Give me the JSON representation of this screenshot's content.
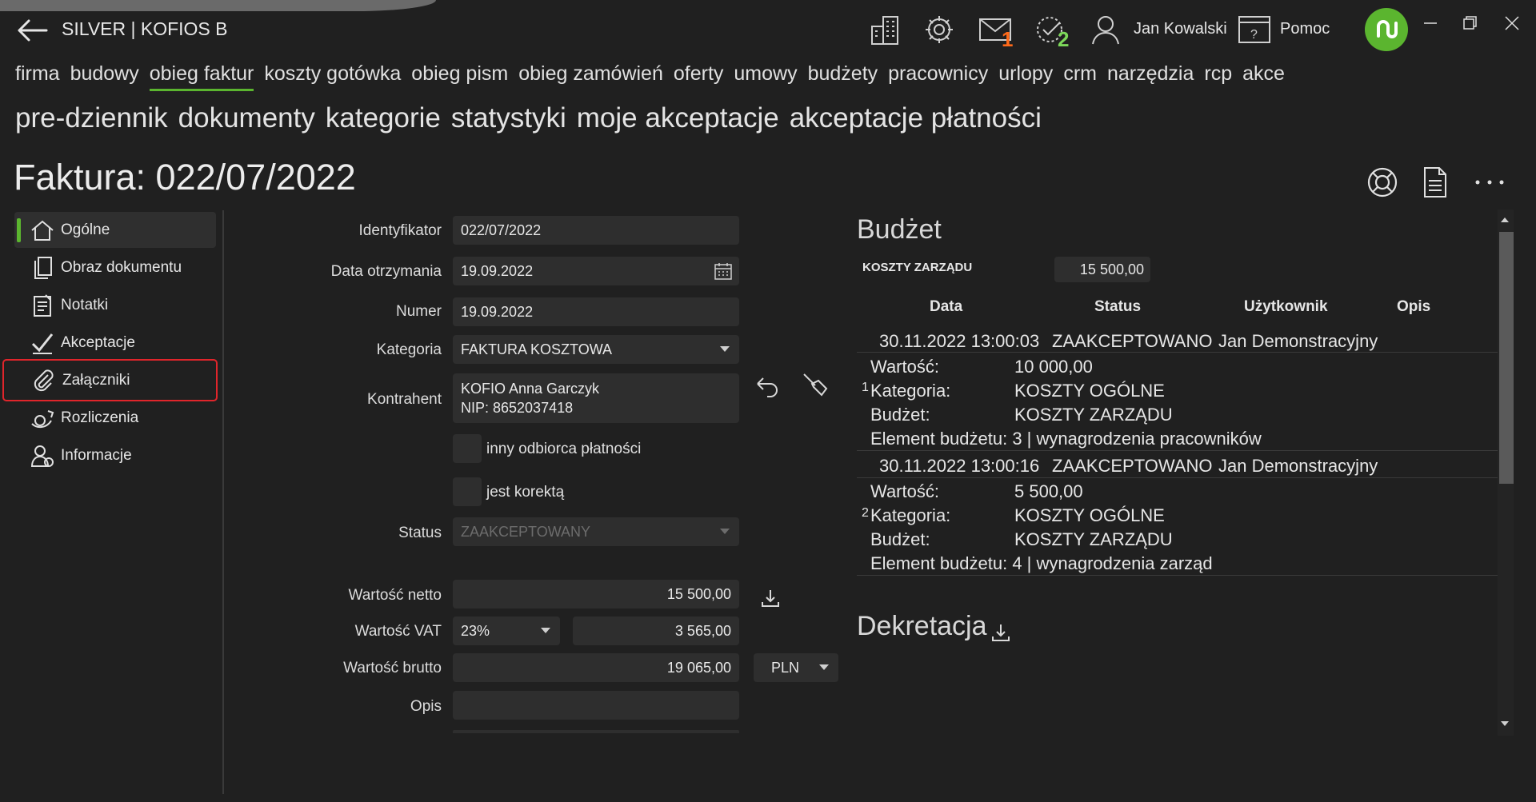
{
  "app": {
    "title": "SILVER | KOFIOS B",
    "user": "Jan Kowalski",
    "help": "Pomoc"
  },
  "badges": {
    "mail": "1",
    "tasks": "2"
  },
  "colors": {
    "accent": "#5bb52f",
    "mail_badge": "#ff6a1a",
    "task_badge": "#7dd85a",
    "highlight": "#e0252b"
  },
  "nav1": [
    "firma",
    "budowy",
    "obieg faktur",
    "koszty gotówka",
    "obieg pism",
    "obieg zamówień",
    "oferty",
    "umowy",
    "budżety",
    "pracownicy",
    "urlopy",
    "crm",
    "narzędzia",
    "rcp",
    "akce"
  ],
  "nav2": [
    "pre-dziennik",
    "dokumenty",
    "kategorie",
    "statystyki",
    "moje akceptacje",
    "akceptacje płatności"
  ],
  "page_title": "Faktura: 022/07/2022",
  "sidebar": [
    {
      "label": "Ogólne",
      "icon": "home-icon"
    },
    {
      "label": "Obraz dokumentu",
      "icon": "document-image-icon"
    },
    {
      "label": "Notatki",
      "icon": "notes-icon"
    },
    {
      "label": "Akceptacje",
      "icon": "checkmark-icon"
    },
    {
      "label": "Załączniki",
      "icon": "paperclip-icon"
    },
    {
      "label": "Rozliczenia",
      "icon": "settlement-icon"
    },
    {
      "label": "Informacje",
      "icon": "info-person-icon"
    }
  ],
  "form": {
    "identyfikator_label": "Identyfikator",
    "identyfikator": "022/07/2022",
    "data_otrzymania_label": "Data otrzymania",
    "data_otrzymania": "19.09.2022",
    "numer_label": "Numer",
    "numer": "19.09.2022",
    "kategoria_label": "Kategoria",
    "kategoria": "FAKTURA KOSZTOWA",
    "kontrahent_label": "Kontrahent",
    "kontrahent_name": "KOFIO Anna Garczyk",
    "kontrahent_nip": "NIP: 8652037418",
    "inny_odbiorca": "inny odbiorca płatności",
    "jest_korekta": "jest korektą",
    "status_label": "Status",
    "status": "ZAAKCEPTOWANY",
    "netto_label": "Wartość netto",
    "netto": "15 500,00",
    "vat_label": "Wartość VAT",
    "vat_rate": "23%",
    "vat": "3 565,00",
    "brutto_label": "Wartość brutto",
    "brutto": "19 065,00",
    "currency": "PLN",
    "opis_label": "Opis",
    "opis": ""
  },
  "budget": {
    "heading": "Budżet",
    "category": "KOSZTY ZARZĄDU",
    "category_value": "15 500,00",
    "headers": {
      "data": "Data",
      "status": "Status",
      "user": "Użytkownik",
      "opis": "Opis"
    },
    "entries": [
      {
        "index": "1",
        "date": "30.11.2022 13:00:03",
        "status": "ZAAKCEPTOWANO",
        "user": "Jan Demonstracyjny",
        "wartosc_label": "Wartość:",
        "wartosc": "10 000,00",
        "kategoria_label": "Kategoria:",
        "kategoria": "KOSZTY OGÓLNE",
        "budzet_label": "Budżet:",
        "budzet": "KOSZTY ZARZĄDU",
        "element": "Element budżetu: 3 | wynagrodzenia pracowników"
      },
      {
        "index": "2",
        "date": "30.11.2022 13:00:16",
        "status": "ZAAKCEPTOWANO",
        "user": "Jan Demonstracyjny",
        "wartosc_label": "Wartość:",
        "wartosc": "5 500,00",
        "kategoria_label": "Kategoria:",
        "kategoria": "KOSZTY OGÓLNE",
        "budzet_label": "Budżet:",
        "budzet": "KOSZTY ZARZĄDU",
        "element": "Element budżetu: 4 | wynagrodzenia zarząd"
      }
    ]
  },
  "dekretacja": {
    "heading": "Dekretacja"
  }
}
